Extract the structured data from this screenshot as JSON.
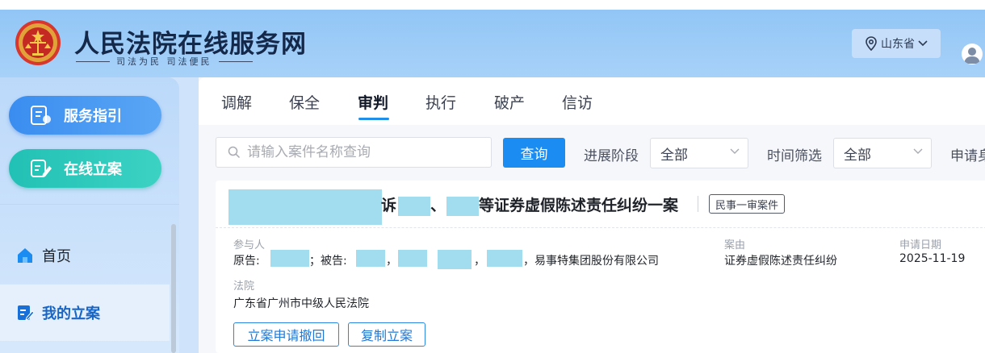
{
  "header": {
    "site_title": "人民法院在线服务网",
    "site_slogan": "司法为民 司法便民",
    "region": "山东省"
  },
  "sidebar": {
    "service_guide": "服务指引",
    "online_filing": "在线立案",
    "nav": [
      {
        "label": "首页"
      },
      {
        "label": "我的立案"
      }
    ]
  },
  "tabs": [
    {
      "label": "调解"
    },
    {
      "label": "保全"
    },
    {
      "label": "审判",
      "active": true
    },
    {
      "label": "执行"
    },
    {
      "label": "破产"
    },
    {
      "label": "信访"
    }
  ],
  "filters": {
    "search_placeholder": "请输入案件名称查询",
    "query_button": "查询",
    "progress_label": "进展阶段",
    "progress_value": "全部",
    "time_label": "时间筛选",
    "time_value": "全部",
    "applicant_label": "申请身"
  },
  "case": {
    "title_parts": [
      "诉",
      "、",
      "等证券虚假陈述责任纠纷一案"
    ],
    "case_type": "民事一审案件",
    "participants_label": "参与人",
    "plaintiff_label": "原告:",
    "defendant_label": "；被告:",
    "defendant_sep1": "，",
    "defendant_sep2": "，",
    "defendant_company": "，易事特集团股份有限公司",
    "cause_label": "案由",
    "cause_value": "证券虚假陈述责任纠纷",
    "date_label": "申请日期",
    "date_value": "2025-11-19",
    "court_label": "法院",
    "court_value": "广东省广州市中级人民法院",
    "withdraw_button": "立案申请撤回",
    "copy_button": "复制立案"
  },
  "colors": {
    "header_bg": "#92c6f6",
    "primary_blue": "#1a8cf2",
    "teal": "#22c1b5",
    "redaction": "#a2dcef"
  }
}
